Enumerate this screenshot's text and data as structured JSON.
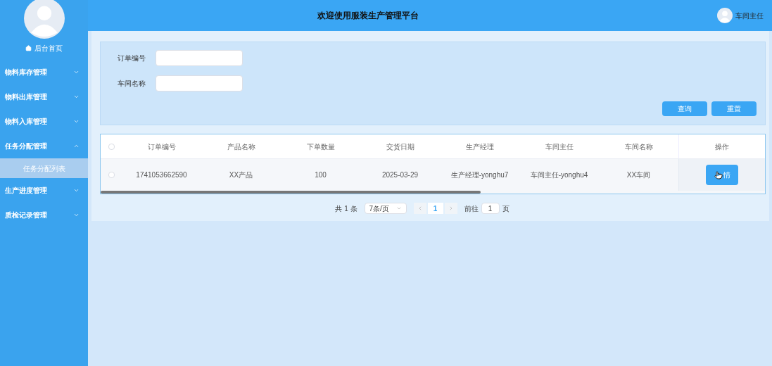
{
  "sidebar": {
    "home": "后台首页",
    "items": [
      {
        "label": "物料库存管理",
        "expanded": false
      },
      {
        "label": "物料出库管理",
        "expanded": false
      },
      {
        "label": "物料入库管理",
        "expanded": false
      },
      {
        "label": "任务分配管理",
        "expanded": true,
        "children": [
          {
            "label": "任务分配列表",
            "selected": true
          }
        ]
      },
      {
        "label": "生产进度管理",
        "expanded": false
      },
      {
        "label": "质检记录管理",
        "expanded": false
      }
    ]
  },
  "header": {
    "title": "欢迎使用服装生产管理平台",
    "user": "车间主任"
  },
  "search": {
    "fields": [
      {
        "label": "订单编号"
      },
      {
        "label": "车间名称"
      }
    ],
    "buttons": [
      "查询",
      "重置"
    ]
  },
  "table": {
    "all_checked": false,
    "columns": [
      "订单编号",
      "产品名称",
      "下单数量",
      "交货日期",
      "生产经理",
      "车间主任",
      "车间名称",
      "操作"
    ],
    "rows": [
      {
        "checked": false,
        "cells": [
          "1741053662590",
          "XX产品",
          "100",
          "2025-03-29",
          "生产经理-yonghu7",
          "车间主任-yonghu4",
          "XX车间"
        ],
        "action": "情"
      }
    ]
  },
  "pagination": {
    "total": "共 1 条",
    "page_size": "7条/页",
    "current": "1",
    "goto_label": "前往",
    "goto_value": "1",
    "page_suffix": "页"
  }
}
